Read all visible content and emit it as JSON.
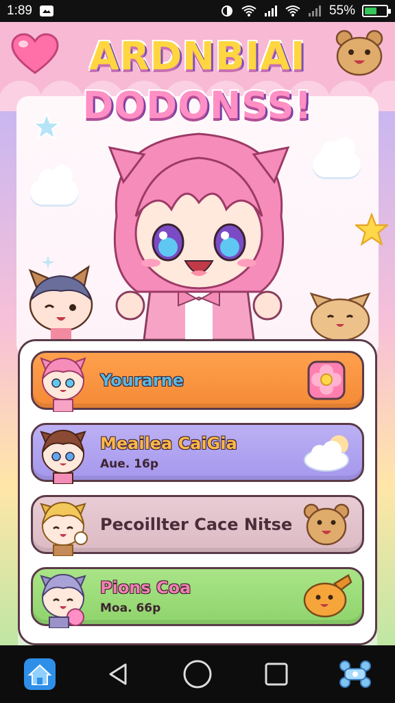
{
  "status_bar": {
    "time": "1:89",
    "battery_percent": "55%",
    "battery_level": 0.55,
    "icons": [
      "screenshot-icon",
      "do-not-disturb-icon",
      "wifi-icon",
      "signal-icon",
      "wifi-icon",
      "signal-icon",
      "battery-icon"
    ]
  },
  "header": {
    "title_line1": "ARDNBIAI",
    "title_line2": "DODONSS!"
  },
  "menu": {
    "items": [
      {
        "title": "Yourarne",
        "subtitle": "",
        "right_icon": "flower-icon"
      },
      {
        "title": "Meailea CaiGia",
        "subtitle": "Aue. 16p",
        "right_icon": "cloud-icon"
      },
      {
        "title": "Pecoillter Cace Nitse",
        "subtitle": "",
        "right_icon": "bear-icon"
      },
      {
        "title": "Pions Coa",
        "subtitle": "Moa. 66p",
        "right_icon": "bread-icon"
      }
    ]
  },
  "nav": {
    "items": [
      "home-icon",
      "back-icon",
      "home-circle-icon",
      "recents-icon",
      "bone-icon"
    ]
  },
  "colors": {
    "accent_pink": "#f7b9d3",
    "orange_button": "#f48a36",
    "purple_button": "#a597ec",
    "rose_button": "#dcbac4",
    "green_button": "#8fd46c",
    "nav_home_blue": "#2e8fe8"
  }
}
